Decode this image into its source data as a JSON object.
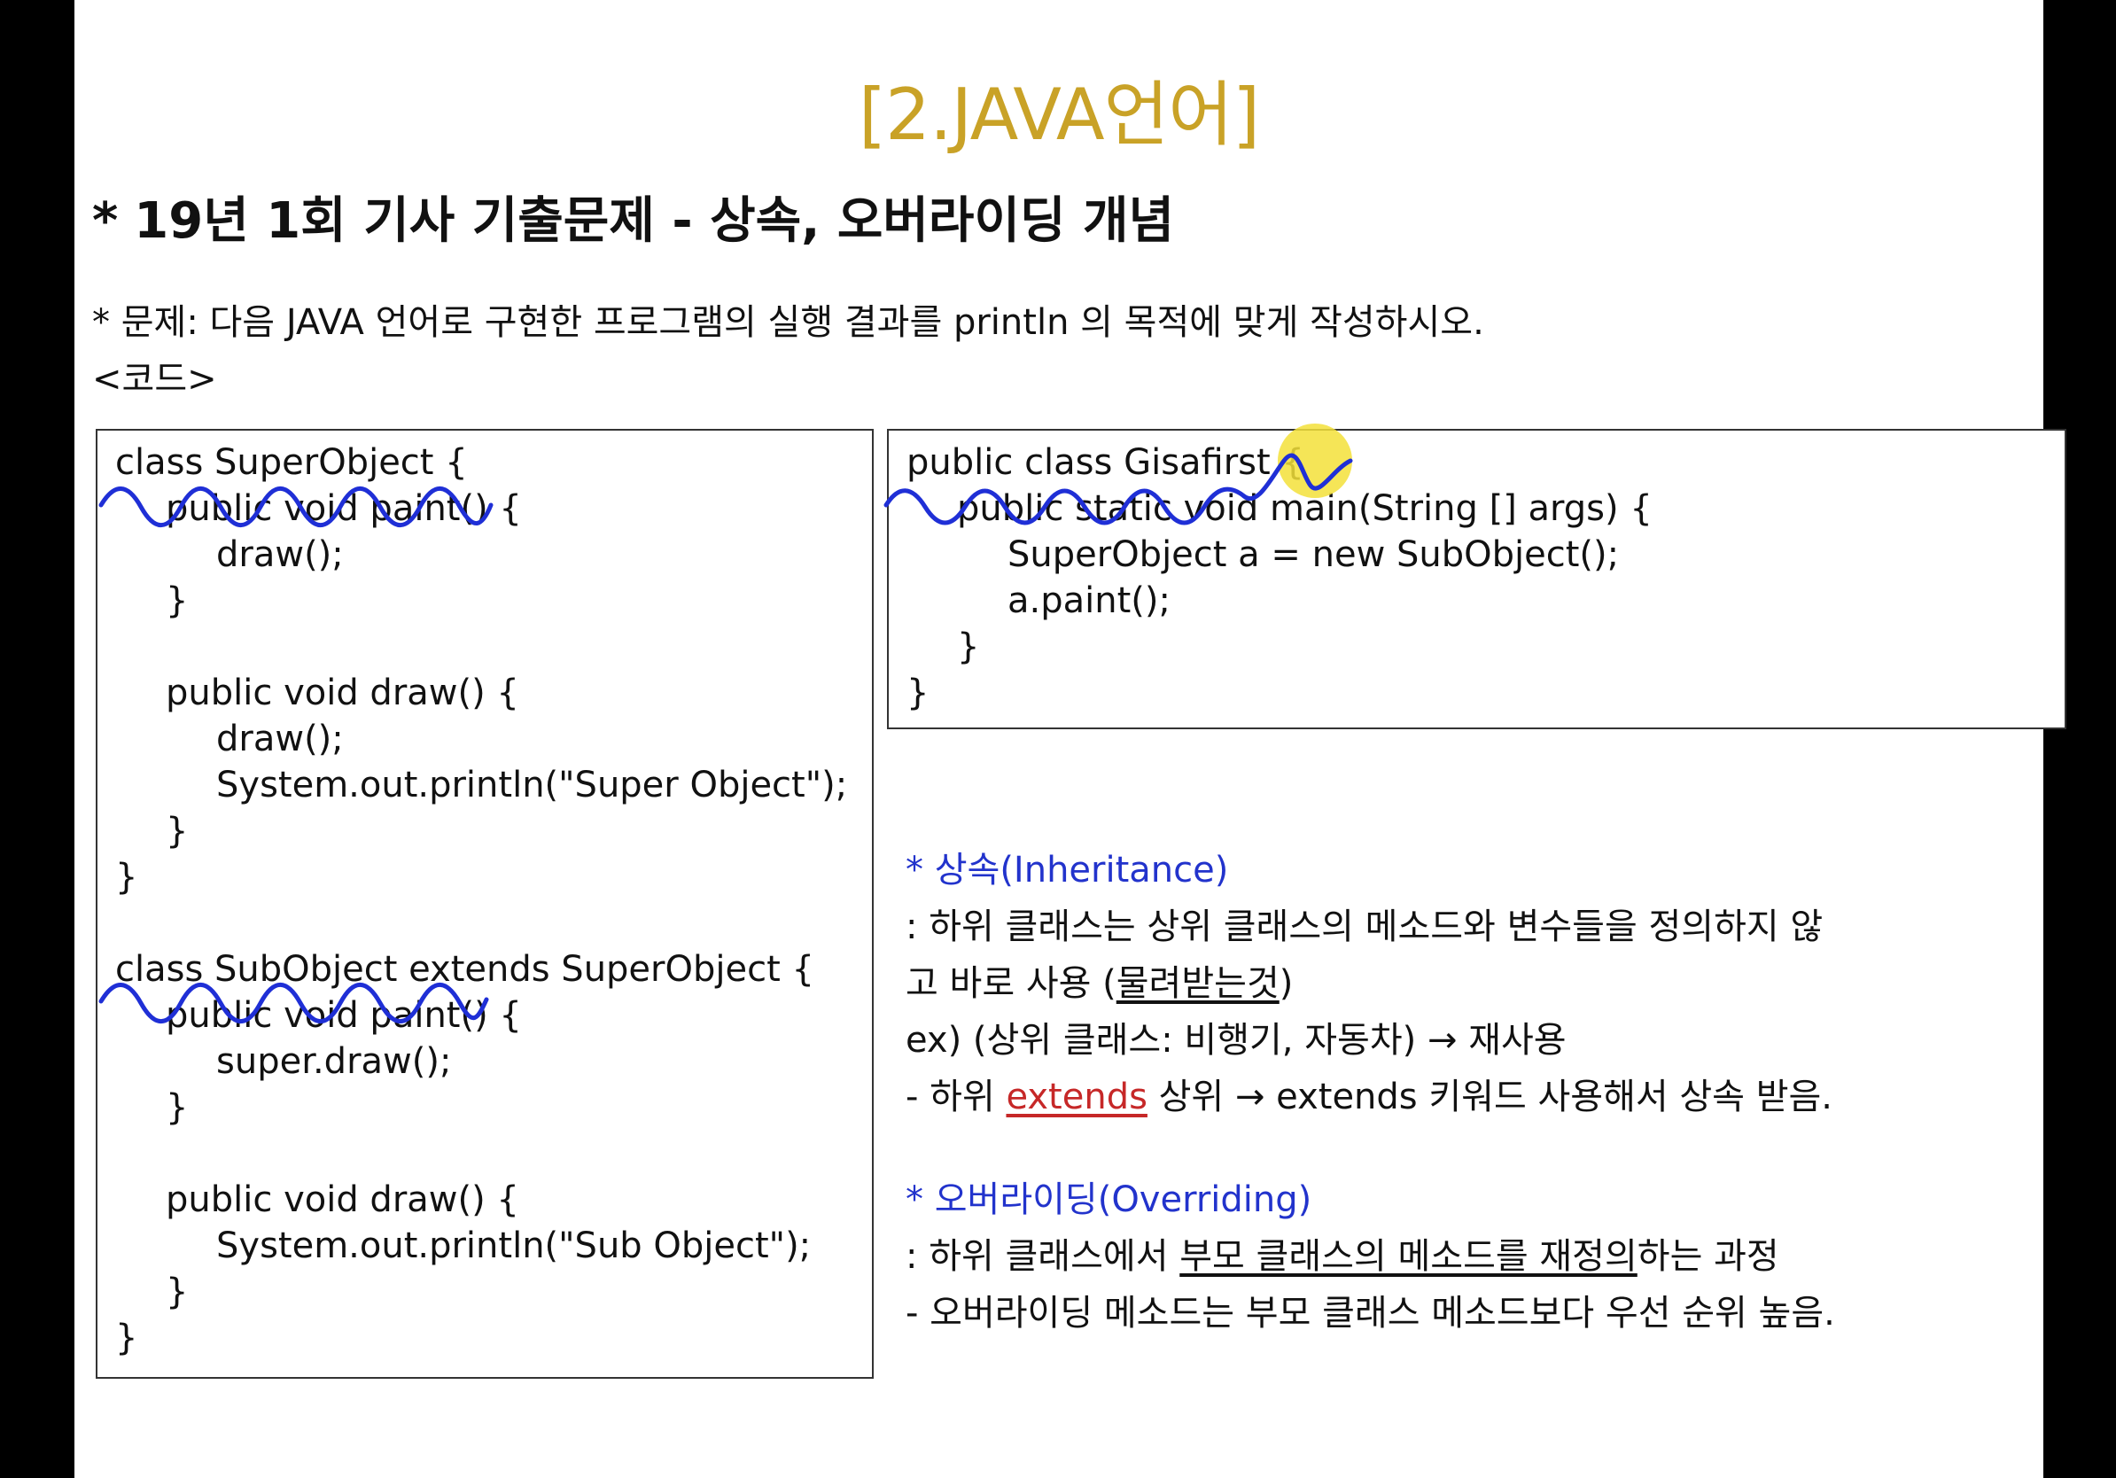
{
  "title": "[2.JAVA언어]",
  "heading": {
    "bullet": "*",
    "text": "19년 1회 기사 기출문제 - 상속, 오버라이딩 개념"
  },
  "problem": "* 문제: 다음 JAVA 언어로 구현한 프로그램의 실행 결과를 println 의 목적에 맞게 작성하시오.",
  "code_label": "<코드>",
  "code_left": [
    "class SuperObject {",
    "public void paint() {",
    "draw();",
    "}",
    "",
    "public void draw() {",
    "draw();",
    "System.out.println(\"Super Object\");",
    "}",
    "}",
    "",
    "class SubObject extends SuperObject {",
    "public void paint() {",
    "super.draw();",
    "}",
    "",
    "public void draw() {",
    "System.out.println(\"Sub Object\");",
    "}",
    "}"
  ],
  "code_right": [
    "public class Gisafirst {",
    "public static void main(String [] args) {",
    "SuperObject a = new SubObject();",
    "a.paint();",
    "}",
    "}"
  ],
  "inheritance": {
    "head": "* 상속(Inheritance)",
    "line1": ": 하위 클래스는 상위 클래스의 메소드와 변수들을 정의하지 않",
    "line2_pre": "고 바로 사용 (",
    "line2_u": "물려받는것",
    "line2_post": ")",
    "line3": "ex) (상위 클래스: 비행기, 자동차) → 재사용",
    "line4_pre": "- 하위 ",
    "line4_red": "extends",
    "line4_post": " 상위 → extends 키워드 사용해서 상속 받음."
  },
  "overriding": {
    "head": "* 오버라이딩(Overriding)",
    "line1_pre": ": 하위 클래스에서 ",
    "line1_u": "부모 클래스의 메소드를 재정의",
    "line1_post": "하는 과정",
    "line2": "- 오버라이딩 메소드는 부모 클래스 메소드보다 우선 순위 높음."
  },
  "colors": {
    "title": "#c9a227",
    "note_head": "#2233cc",
    "extends_red": "#c62828",
    "annotation_blue": "#1f2fd6",
    "highlight": "#f3e03a"
  }
}
